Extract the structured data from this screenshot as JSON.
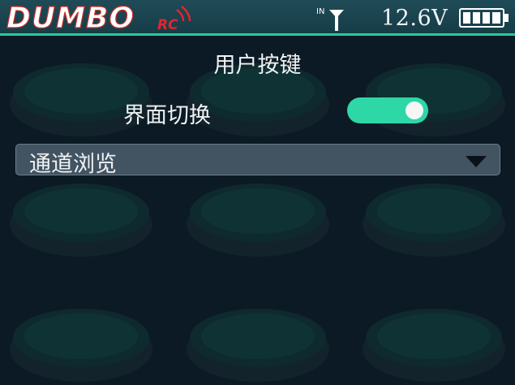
{
  "status_bar": {
    "logo_text": "DUMBO",
    "logo_subtext": "RC",
    "antenna_label": "IN",
    "voltage": "12.6V",
    "battery_icon": "battery-full-icon",
    "signal_icon": "antenna-icon"
  },
  "screen": {
    "title": "用户按键",
    "toggle": {
      "label": "界面切换",
      "on": true
    },
    "dropdown": {
      "selected": "通道浏览",
      "icon": "triangle-down-icon"
    }
  },
  "colors": {
    "background": "#0b1a24",
    "accent": "#2ed7a6",
    "status_bar": "#1f4b57",
    "logo_red": "#e2262f"
  }
}
